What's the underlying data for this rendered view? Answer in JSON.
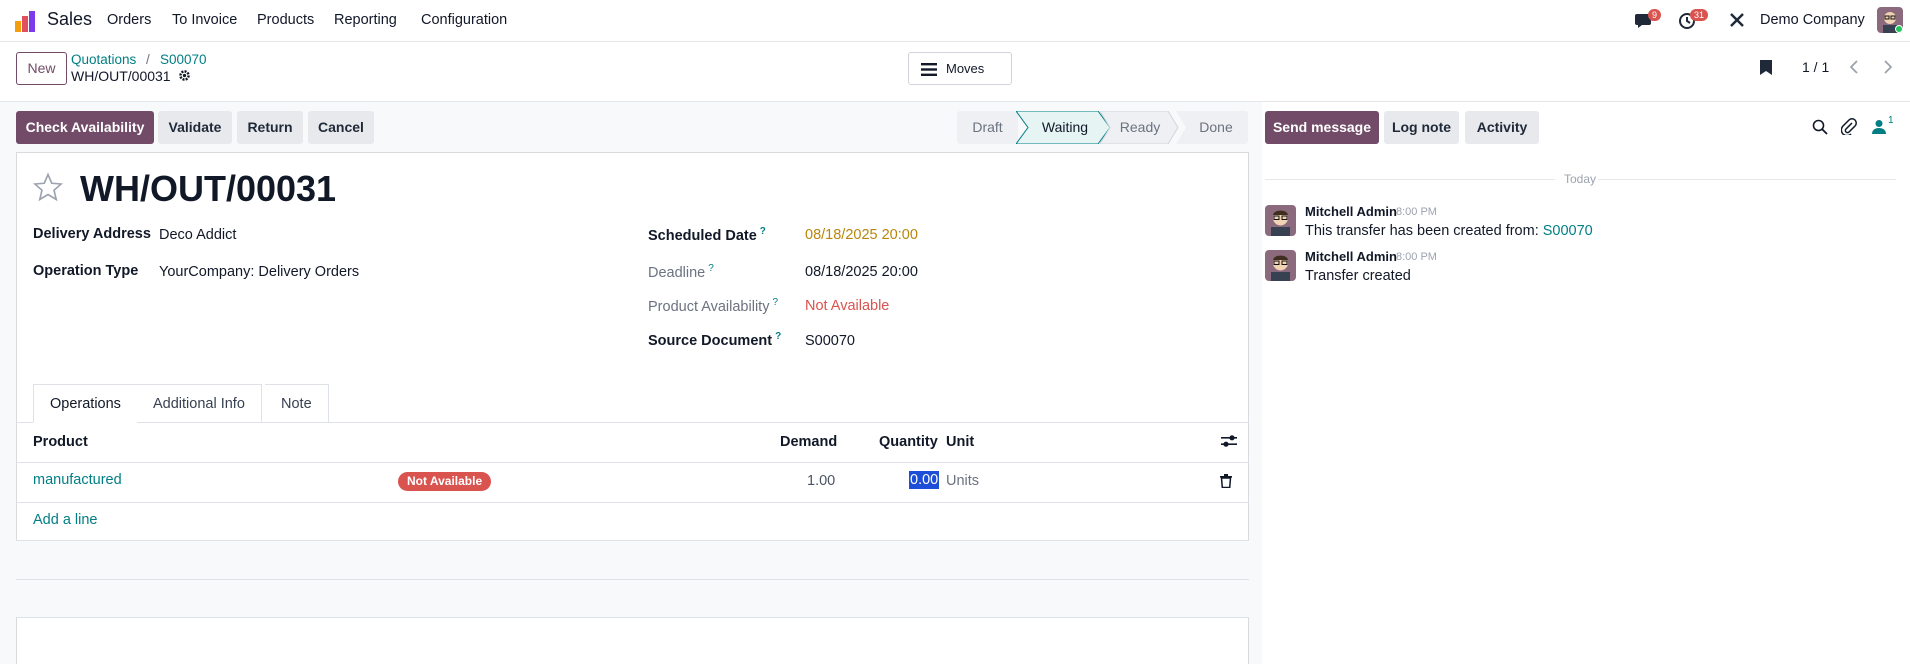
{
  "navbar": {
    "app_name": "Sales",
    "menu": [
      "Orders",
      "To Invoice",
      "Products",
      "Reporting",
      "Configuration"
    ],
    "messages_count": "9",
    "activities_count": "31",
    "company": "Demo Company"
  },
  "control_panel": {
    "new_label": "New",
    "breadcrumbs": [
      "Quotations",
      "S00070"
    ],
    "current_record": "WH/OUT/00031",
    "moves_label": "Moves",
    "pager": "1 / 1"
  },
  "actions": {
    "check_availability": "Check Availability",
    "validate": "Validate",
    "return": "Return",
    "cancel": "Cancel"
  },
  "stages": [
    "Draft",
    "Waiting",
    "Ready",
    "Done"
  ],
  "active_stage": "Waiting",
  "form": {
    "title": "WH/OUT/00031",
    "delivery_address_label": "Delivery Address",
    "delivery_address": "Deco Addict",
    "operation_type_label": "Operation Type",
    "operation_type": "YourCompany: Delivery Orders",
    "scheduled_date_label": "Scheduled Date",
    "scheduled_date": "08/18/2025 20:00",
    "deadline_label": "Deadline",
    "deadline": "08/18/2025 20:00",
    "product_availability_label": "Product Availability",
    "product_availability": "Not Available",
    "source_document_label": "Source Document",
    "source_document": "S00070",
    "qmark": "?"
  },
  "tabs": [
    "Operations",
    "Additional Info",
    "Note"
  ],
  "table": {
    "headers": {
      "product": "Product",
      "demand": "Demand",
      "quantity": "Quantity",
      "unit": "Unit"
    },
    "rows": [
      {
        "product": "manufactured",
        "badge": "Not Available",
        "demand": "1.00",
        "quantity": "0.00",
        "unit": "Units"
      }
    ],
    "add_line": "Add a line"
  },
  "chatter": {
    "send_message": "Send message",
    "log_note": "Log note",
    "activity": "Activity",
    "followers_count": "1",
    "date_separator": "Today",
    "messages": [
      {
        "author": "Mitchell Admin",
        "time": "8:00 PM",
        "text": "This transfer has been created from: ",
        "link": "S00070"
      },
      {
        "author": "Mitchell Admin",
        "time": "8:00 PM",
        "text": "Transfer created"
      }
    ]
  },
  "colors": {
    "brand": "#714b67",
    "link": "#017e84",
    "danger": "#d9534f",
    "warning": "#b8860b"
  }
}
